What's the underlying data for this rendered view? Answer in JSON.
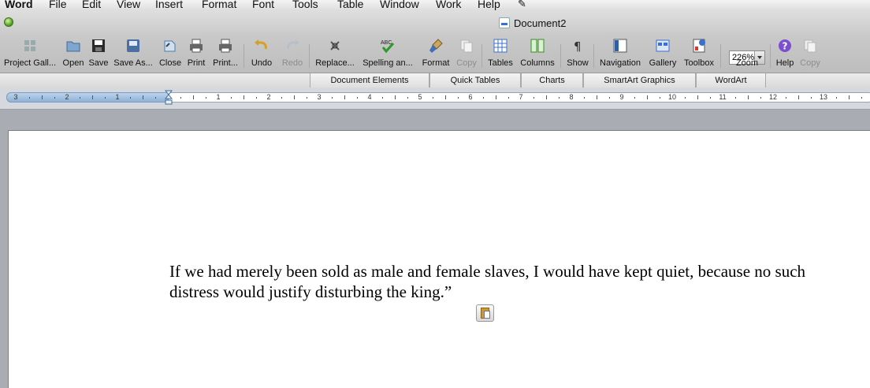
{
  "menubar": {
    "app": "Word",
    "items": [
      "File",
      "Edit",
      "View",
      "Insert",
      "Format",
      "Font",
      "Tools",
      "Table",
      "Window",
      "Work",
      "Help"
    ]
  },
  "window": {
    "title": "Document2"
  },
  "toolbar": {
    "project_gallery": "Project Gall...",
    "open": "Open",
    "save": "Save",
    "save_as": "Save As...",
    "close": "Close",
    "print": "Print",
    "print_dialog": "Print...",
    "undo": "Undo",
    "redo": "Redo",
    "replace": "Replace...",
    "spelling": "Spelling an...",
    "format": "Format",
    "copy": "Copy",
    "tables": "Tables",
    "columns": "Columns",
    "show": "Show",
    "navigation": "Navigation",
    "gallery": "Gallery",
    "toolbox": "Toolbox",
    "zoom_value": "226%",
    "zoom": "Zoom",
    "help": "Help",
    "copy2": "Copy"
  },
  "ribbon": {
    "tabs": [
      "Document Elements",
      "Quick Tables",
      "Charts",
      "SmartArt Graphics",
      "WordArt"
    ]
  },
  "ruler": {
    "left_labels": [
      "3",
      "2",
      "1"
    ],
    "right_labels": [
      "1",
      "2",
      "3",
      "4",
      "5",
      "6",
      "7",
      "8",
      "9",
      "10",
      "11",
      "12",
      "13"
    ]
  },
  "document": {
    "line1": "If we had merely been sold as male and female slaves, I would have kept quiet, because no such",
    "line2": "distress would justify disturbing the king.”"
  },
  "colors": {
    "accent": "#3b6fd0",
    "ruler_margin": "#8fb1d6",
    "zoom_help": "#7b4fd0"
  }
}
